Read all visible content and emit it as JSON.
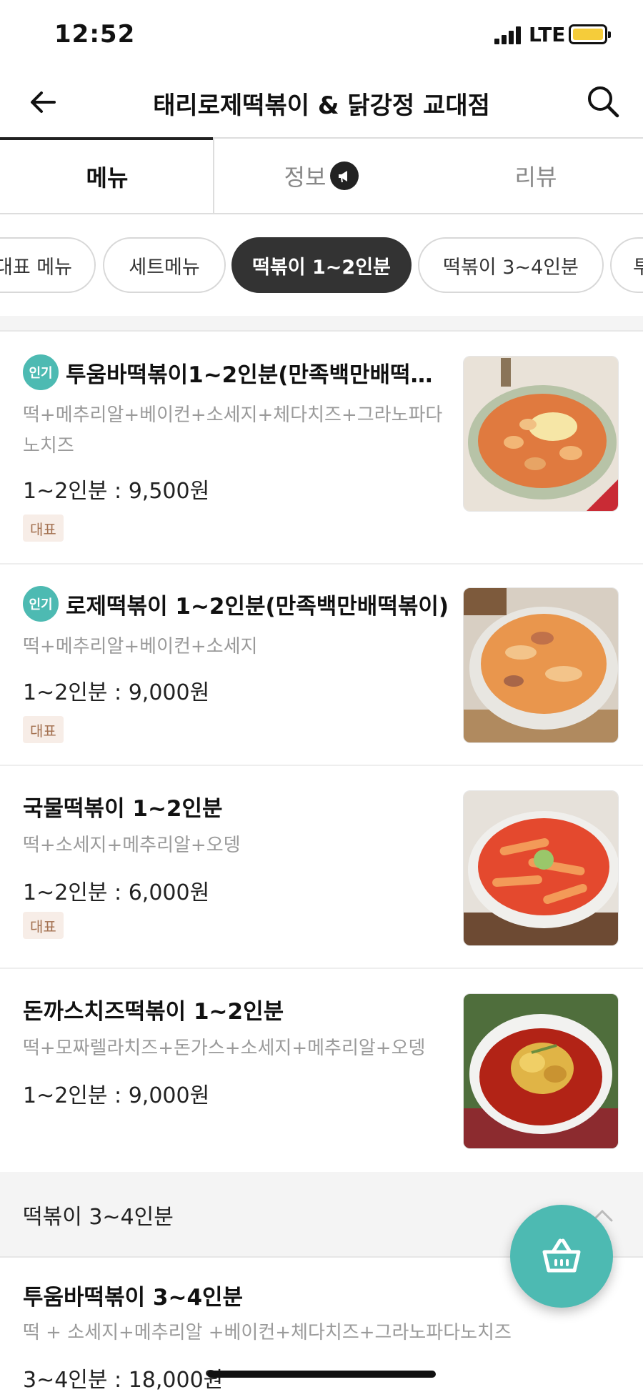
{
  "status_bar": {
    "time": "12:52",
    "network": "LTE",
    "battery_color": "#f5cc3a"
  },
  "header": {
    "title": "태리로제떡볶이 & 닭강정 교대점",
    "back_icon": "arrow-left-icon",
    "search_icon": "search-icon"
  },
  "tabs": [
    {
      "label": "메뉴",
      "active": true
    },
    {
      "label": "정보",
      "icon": "megaphone-icon"
    },
    {
      "label": "리뷰"
    }
  ],
  "chips": [
    {
      "label": "대표 메뉴"
    },
    {
      "label": "세트메뉴"
    },
    {
      "label": "떡볶이 1~2인분",
      "active": true
    },
    {
      "label": "떡볶이 3~4인분"
    },
    {
      "label": "투"
    }
  ],
  "menu_items": [
    {
      "badge": "인기",
      "name": "투움바떡볶이1~2인분(만족백만배떡…",
      "description": "떡+메추리알+베이컨+소세지+체다치즈+그라노파다노치즈",
      "price": "1~2인분 : 9,500원",
      "tag": "대표"
    },
    {
      "badge": "인기",
      "name": "로제떡볶이 1~2인분(만족백만배떡볶이)",
      "description": "떡+메추리알+베이컨+소세지",
      "price": "1~2인분 : 9,000원",
      "tag": "대표"
    },
    {
      "name": "국물떡볶이 1~2인분",
      "description": "떡+소세지+메추리알+오뎅",
      "price": "1~2인분 : 6,000원",
      "tag": "대표"
    },
    {
      "name": "돈까스치즈떡볶이 1~2인분",
      "description": "떡+모짜렐라치즈+돈가스+소세지+메추리알+오뎅",
      "price": "1~2인분 : 9,000원"
    }
  ],
  "section": {
    "title": "떡볶이 3~4인분",
    "items": [
      {
        "name": "투움바떡볶이 3~4인분",
        "description": "떡 + 소세지+메추리알 +베이컨+체다치즈+그라노파다노치즈",
        "price": "3~4인분 : 18,000원"
      }
    ]
  },
  "colors": {
    "accent": "#4dbab2",
    "tag_bg": "#f7ede7",
    "tag_text": "#a3704f",
    "chip_active": "#333333"
  },
  "cart_icon": "basket-icon"
}
